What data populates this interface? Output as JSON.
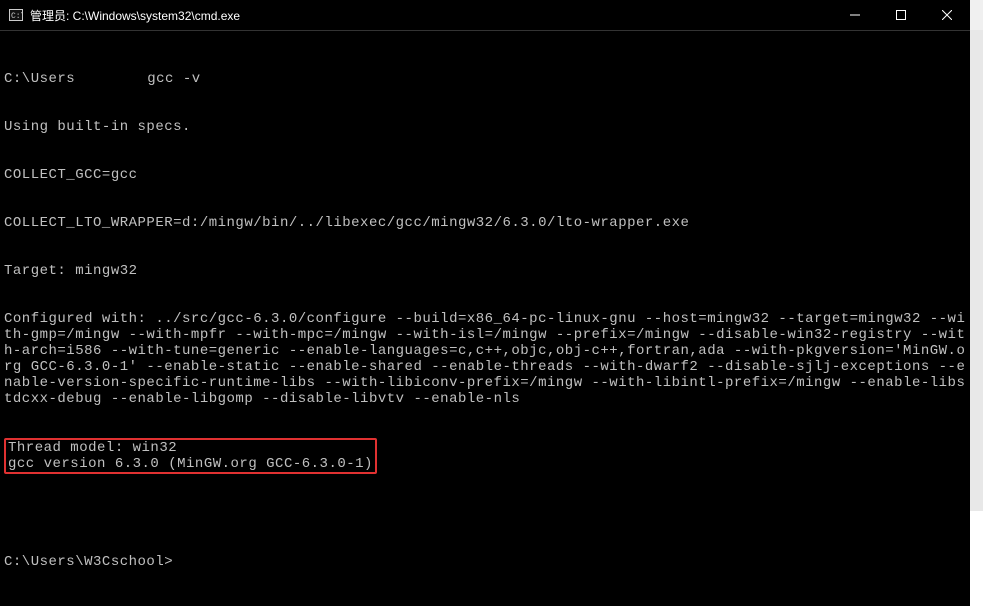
{
  "window": {
    "title": "管理员: C:\\Windows\\system32\\cmd.exe"
  },
  "terminal": {
    "prompt1_prefix": "C:\\Users",
    "prompt1_suffix": "gcc -v",
    "line_specs": "Using built-in specs.",
    "line_collect_gcc": "COLLECT_GCC=gcc",
    "line_wrapper": "COLLECT_LTO_WRAPPER=d:/mingw/bin/../libexec/gcc/mingw32/6.3.0/lto-wrapper.exe",
    "line_target": "Target: mingw32",
    "line_configured": "Configured with: ../src/gcc-6.3.0/configure --build=x86_64-pc-linux-gnu --host=mingw32 --target=mingw32 --with-gmp=/mingw --with-mpfr --with-mpc=/mingw --with-isl=/mingw --prefix=/mingw --disable-win32-registry --with-arch=i586 --with-tune=generic --enable-languages=c,c++,objc,obj-c++,fortran,ada --with-pkgversion='MinGW.org GCC-6.3.0-1' --enable-static --enable-shared --enable-threads --with-dwarf2 --disable-sjlj-exceptions --enable-version-specific-runtime-libs --with-libiconv-prefix=/mingw --with-libintl-prefix=/mingw --enable-libstdcxx-debug --enable-libgomp --disable-libvtv --enable-nls",
    "line_thread_model": "Thread model: win32",
    "line_version": "gcc version 6.3.0 (MinGW.org GCC-6.3.0-1)",
    "prompt2": "C:\\Users\\W3Cschool>"
  },
  "icons": {
    "cmd": "cmd-icon",
    "minimize": "minimize-icon",
    "maximize": "maximize-icon",
    "close": "close-icon"
  }
}
